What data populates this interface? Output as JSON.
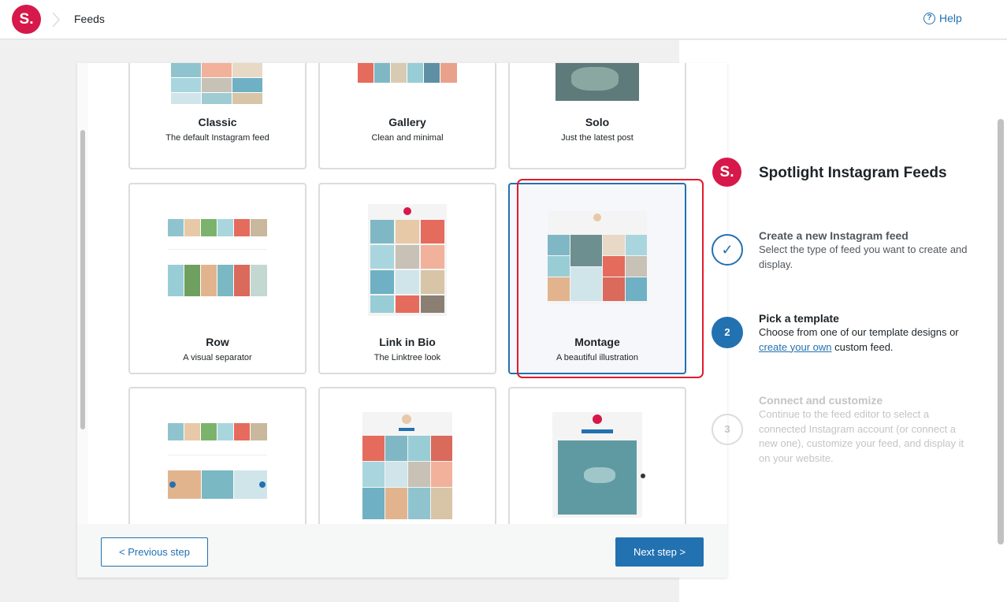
{
  "topbar": {
    "logo": "S.",
    "breadcrumb": "Feeds",
    "help_label": "Help",
    "help_icon": "?"
  },
  "templates": [
    {
      "name": "Classic",
      "description": "The default Instagram feed"
    },
    {
      "name": "Gallery",
      "description": "Clean and minimal"
    },
    {
      "name": "Solo",
      "description": "Just the latest post"
    },
    {
      "name": "Row",
      "description": "A visual separator"
    },
    {
      "name": "Link in Bio",
      "description": "The Linktree look"
    },
    {
      "name": "Montage",
      "description": "A beautiful illustration",
      "selected": true
    }
  ],
  "footer": {
    "prev_label": "< Previous step",
    "next_label": "Next step >"
  },
  "sidebar": {
    "logo": "S.",
    "title": "Spotlight Instagram Feeds",
    "steps": [
      {
        "number": "✓",
        "title": "Create a new Instagram feed",
        "description": "Select the type of feed you want to create and display.",
        "state": "done"
      },
      {
        "number": "2",
        "title": "Pick a template",
        "description_before": "Choose from one of our template designs or ",
        "link": "create your own",
        "description_after": " custom feed.",
        "state": "active"
      },
      {
        "number": "3",
        "title": "Connect and customize",
        "description": "Continue to the feed editor to select a connected Instagram account (or connect a new one), customize your feed, and display it on your website.",
        "state": "pending"
      }
    ]
  },
  "colors": {
    "accent": "#2271b1",
    "brand": "#d6194a",
    "selection": "#e01b2c",
    "muted": "#c3c4c7"
  }
}
